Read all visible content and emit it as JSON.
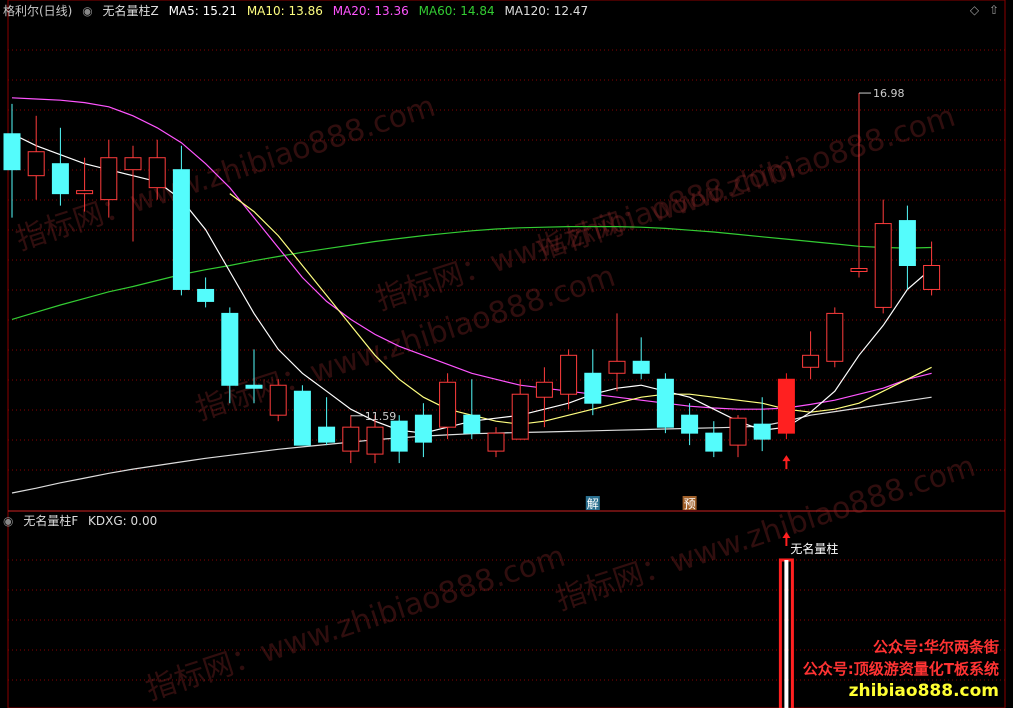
{
  "header": {
    "stock": "格利尔(日线)",
    "indicator": "无名量柱Z",
    "ma5": "MA5: 15.21",
    "ma10": "MA10: 13.86",
    "ma20": "MA20: 13.36",
    "ma60": "MA60: 14.84",
    "ma120": "MA120: 12.47"
  },
  "sub_header": {
    "indicator": "无名量柱F",
    "kdxg": "KDXG: 0.00"
  },
  "colors": {
    "up": "#ff3c3c",
    "down": "#54fcfc",
    "ma5": "#ffffff",
    "ma10": "#ffff80",
    "ma20": "#ff55ff",
    "ma60": "#33cc33",
    "ma120": "#dddddd",
    "grid": "#8b0000"
  },
  "badges": {
    "jie": "解",
    "yu": "预"
  },
  "signal_label": "无名量柱",
  "watermarks": [
    "指标网：www.zhibiao888.com"
  ],
  "brand_lines": [
    "公众号:华尔两条街",
    "公众号:顶级游资量化T板系统",
    "zhibiao888.com"
  ],
  "chart_data": {
    "type": "candlestick",
    "price_range": [
      10.1,
      18.2
    ],
    "annotations": [
      {
        "text": "16.98",
        "value": 16.98,
        "candle": 35
      },
      {
        "text": "11.59",
        "value": 11.59,
        "candle": 14
      }
    ],
    "candles": [
      {
        "o": 16.3,
        "c": 15.7,
        "h": 16.8,
        "l": 14.9
      },
      {
        "o": 15.6,
        "c": 16.0,
        "h": 16.6,
        "l": 15.2
      },
      {
        "o": 15.8,
        "c": 15.3,
        "h": 16.4,
        "l": 15.1
      },
      {
        "o": 15.3,
        "c": 15.35,
        "h": 15.9,
        "l": 15.0
      },
      {
        "o": 15.2,
        "c": 15.9,
        "h": 16.2,
        "l": 14.9
      },
      {
        "o": 15.7,
        "c": 15.9,
        "h": 16.1,
        "l": 14.5
      },
      {
        "o": 15.4,
        "c": 15.9,
        "h": 16.2,
        "l": 15.2
      },
      {
        "o": 15.7,
        "c": 13.7,
        "h": 16.1,
        "l": 13.6
      },
      {
        "o": 13.7,
        "c": 13.5,
        "h": 13.9,
        "l": 13.4
      },
      {
        "o": 13.3,
        "c": 12.1,
        "h": 13.4,
        "l": 11.8
      },
      {
        "o": 12.1,
        "c": 12.05,
        "h": 12.7,
        "l": 11.8
      },
      {
        "o": 11.6,
        "c": 12.1,
        "h": 12.2,
        "l": 11.5
      },
      {
        "o": 12.0,
        "c": 11.1,
        "h": 12.1,
        "l": 11.1
      },
      {
        "o": 11.4,
        "c": 11.15,
        "h": 11.9,
        "l": 11.1
      },
      {
        "o": 11.0,
        "c": 11.4,
        "h": 11.6,
        "l": 10.8
      },
      {
        "o": 10.95,
        "c": 11.4,
        "h": 11.6,
        "l": 10.8
      },
      {
        "o": 11.5,
        "c": 11.0,
        "h": 11.6,
        "l": 10.8
      },
      {
        "o": 11.6,
        "c": 11.15,
        "h": 11.8,
        "l": 10.9
      },
      {
        "o": 11.4,
        "c": 12.15,
        "h": 12.3,
        "l": 11.2
      },
      {
        "o": 11.6,
        "c": 11.3,
        "h": 12.2,
        "l": 11.2
      },
      {
        "o": 11.0,
        "c": 11.3,
        "h": 11.4,
        "l": 10.9
      },
      {
        "o": 11.2,
        "c": 11.95,
        "h": 12.2,
        "l": 11.2
      },
      {
        "o": 11.9,
        "c": 12.15,
        "h": 12.4,
        "l": 11.4
      },
      {
        "o": 11.95,
        "c": 12.6,
        "h": 12.7,
        "l": 11.7
      },
      {
        "o": 12.3,
        "c": 11.8,
        "h": 12.7,
        "l": 11.6
      },
      {
        "o": 12.3,
        "c": 12.5,
        "h": 13.3,
        "l": 12.0
      },
      {
        "o": 12.5,
        "c": 12.3,
        "h": 12.9,
        "l": 12.2
      },
      {
        "o": 12.2,
        "c": 11.4,
        "h": 12.3,
        "l": 11.3
      },
      {
        "o": 11.6,
        "c": 11.3,
        "h": 11.8,
        "l": 11.1
      },
      {
        "o": 11.3,
        "c": 11.0,
        "h": 11.5,
        "l": 10.9
      },
      {
        "o": 11.1,
        "c": 11.55,
        "h": 11.6,
        "l": 10.9
      },
      {
        "o": 11.45,
        "c": 11.2,
        "h": 11.9,
        "l": 11.0
      },
      {
        "o": 11.3,
        "c": 12.2,
        "h": 12.3,
        "l": 11.2
      },
      {
        "o": 12.4,
        "c": 12.6,
        "h": 13.0,
        "l": 12.2
      },
      {
        "o": 12.5,
        "c": 13.3,
        "h": 13.4,
        "l": 12.4
      },
      {
        "o": 14.0,
        "c": 14.05,
        "h": 16.98,
        "l": 13.9
      },
      {
        "o": 13.4,
        "c": 14.8,
        "h": 15.2,
        "l": 13.3
      },
      {
        "o": 14.85,
        "c": 14.1,
        "h": 15.1,
        "l": 13.7
      },
      {
        "o": 13.7,
        "c": 14.1,
        "h": 14.5,
        "l": 13.6
      }
    ],
    "ma5": [
      16.3,
      16.1,
      15.95,
      15.8,
      15.7,
      15.6,
      15.5,
      15.2,
      14.7,
      14.0,
      13.3,
      12.7,
      12.3,
      12.0,
      11.7,
      11.5,
      11.35,
      11.3,
      11.4,
      11.5,
      11.55,
      11.6,
      11.7,
      11.8,
      11.95,
      12.05,
      12.1,
      12.0,
      11.9,
      11.7,
      11.5,
      11.35,
      11.4,
      11.65,
      12.0,
      12.6,
      13.1,
      13.7,
      14.05
    ],
    "ma10": [
      null,
      null,
      null,
      null,
      null,
      null,
      null,
      null,
      null,
      15.3,
      15.0,
      14.6,
      14.1,
      13.6,
      13.1,
      12.6,
      12.2,
      11.9,
      11.7,
      11.6,
      11.5,
      11.45,
      11.5,
      11.6,
      11.7,
      11.8,
      11.9,
      11.95,
      11.95,
      11.9,
      11.85,
      11.8,
      11.7,
      11.65,
      11.7,
      11.8,
      12.0,
      12.2,
      12.4
    ],
    "ma20": [
      16.9,
      16.88,
      16.86,
      16.82,
      16.75,
      16.6,
      16.4,
      16.15,
      15.8,
      15.4,
      14.9,
      14.4,
      13.9,
      13.5,
      13.2,
      12.95,
      12.75,
      12.6,
      12.45,
      12.3,
      12.2,
      12.1,
      12.05,
      12.0,
      11.95,
      11.9,
      11.85,
      11.8,
      11.75,
      11.72,
      11.7,
      11.7,
      11.72,
      11.78,
      11.85,
      11.95,
      12.05,
      12.2,
      12.3
    ],
    "ma60": [
      13.2,
      13.32,
      13.44,
      13.55,
      13.66,
      13.75,
      13.85,
      13.95,
      14.03,
      14.1,
      14.18,
      14.25,
      14.32,
      14.38,
      14.44,
      14.5,
      14.55,
      14.6,
      14.64,
      14.68,
      14.71,
      14.73,
      14.74,
      14.75,
      14.75,
      14.75,
      14.74,
      14.72,
      14.69,
      14.66,
      14.62,
      14.58,
      14.54,
      14.5,
      14.46,
      14.42,
      14.4,
      14.39,
      14.4
    ],
    "ma120": [
      10.3,
      10.38,
      10.47,
      10.55,
      10.63,
      10.7,
      10.76,
      10.82,
      10.88,
      10.93,
      10.98,
      11.03,
      11.07,
      11.11,
      11.15,
      11.19,
      11.22,
      11.25,
      11.27,
      11.29,
      11.3,
      11.31,
      11.32,
      11.33,
      11.34,
      11.35,
      11.36,
      11.37,
      11.38,
      11.39,
      11.4,
      11.42,
      11.5,
      11.6,
      11.66,
      11.72,
      11.78,
      11.84,
      11.9
    ],
    "signal_candles": [
      32
    ]
  }
}
